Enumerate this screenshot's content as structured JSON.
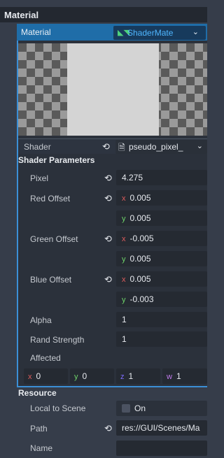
{
  "material_section": {
    "title": "Material"
  },
  "material_property": {
    "label": "Material",
    "reset_icon": "reset-icon",
    "value": "ShaderMate",
    "resource_icon": "shader-material-icon"
  },
  "shader": {
    "label": "Shader",
    "value": "pseudo_pixel_",
    "file_icon": "shader-file-icon"
  },
  "shader_parameters": {
    "title": "Shader Parameters",
    "pixel": {
      "label": "Pixel",
      "value": "4.275"
    },
    "red_offset": {
      "label": "Red Offset",
      "x": "0.005",
      "y": "0.005"
    },
    "green_offset": {
      "label": "Green Offset",
      "x": "-0.005",
      "y": "0.005"
    },
    "blue_offset": {
      "label": "Blue Offset",
      "x": "0.005",
      "y": "-0.003"
    },
    "alpha": {
      "label": "Alpha",
      "value": "1"
    },
    "rand_strength": {
      "label": "Rand Strength",
      "value": "1"
    },
    "affected": {
      "label": "Affected",
      "x": "0",
      "y": "0",
      "z": "1",
      "w": "1"
    }
  },
  "axis_labels": {
    "x": "x",
    "y": "y",
    "z": "z",
    "w": "w"
  },
  "resource": {
    "title": "Resource",
    "local_to_scene": {
      "label": "Local to Scene",
      "value": "On",
      "checked": false
    },
    "path": {
      "label": "Path",
      "value": "res://GUI/Scenes/Ma"
    },
    "name": {
      "label": "Name",
      "value": ""
    }
  },
  "colors": {
    "accent": "#3b8fd6",
    "axis_x": "#e05d5d",
    "axis_y": "#6ed36a",
    "axis_z": "#7e6bff",
    "axis_w": "#c37cf0"
  }
}
